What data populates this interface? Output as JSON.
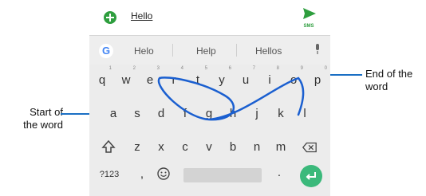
{
  "compose": {
    "message": "Hello",
    "send_label": "SMS"
  },
  "suggestions": [
    "Helo",
    "Help",
    "Hellos"
  ],
  "rows": {
    "top": [
      {
        "k": "q",
        "n": "1"
      },
      {
        "k": "w",
        "n": "2"
      },
      {
        "k": "e",
        "n": "3"
      },
      {
        "k": "r",
        "n": "4"
      },
      {
        "k": "t",
        "n": "5"
      },
      {
        "k": "y",
        "n": "6"
      },
      {
        "k": "u",
        "n": "7"
      },
      {
        "k": "i",
        "n": "8"
      },
      {
        "k": "o",
        "n": "9"
      },
      {
        "k": "p",
        "n": "0"
      }
    ],
    "middle": [
      "a",
      "s",
      "d",
      "f",
      "g",
      "h",
      "j",
      "k",
      "l"
    ],
    "bottom": [
      "z",
      "x",
      "c",
      "v",
      "b",
      "n",
      "m"
    ]
  },
  "function_keys": {
    "symbols": "?123",
    "comma": ",",
    "period": "."
  },
  "callouts": {
    "start": [
      "Start of",
      "the word"
    ],
    "end": [
      "End of the",
      "word"
    ]
  },
  "colors": {
    "accent_green": "#2e9e3e",
    "enter_green": "#3bb97b",
    "gesture_trail": "#1a5fd0"
  }
}
